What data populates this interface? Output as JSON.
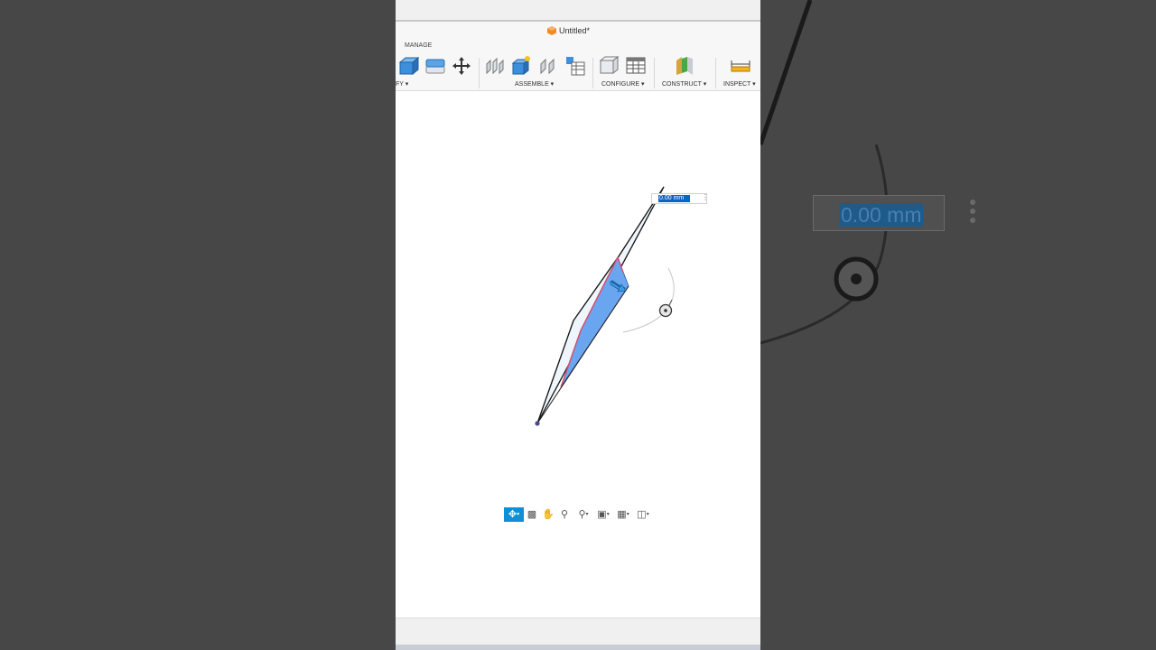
{
  "window": {
    "title": "Untitled*"
  },
  "toolbar": {
    "tab_label": "MANAGE",
    "groups": [
      {
        "label": "FY ▾"
      },
      {
        "label": "ASSEMBLE ▾"
      },
      {
        "label": "CONFIGURE ▾"
      },
      {
        "label": "CONSTRUCT ▾"
      },
      {
        "label": "INSPECT ▾"
      }
    ]
  },
  "dimension": {
    "value": "0.00 mm"
  },
  "background_zoom": {
    "value": "0.00 mm"
  },
  "icons": {
    "modify": [
      "press-pull-icon",
      "fillet-icon",
      "move-icon"
    ],
    "assemble": [
      "joint-icon",
      "new-component-icon",
      "as-built-joint-icon",
      "bom-icon"
    ],
    "configure": [
      "configure-icon",
      "table-icon"
    ],
    "construct": [
      "plane-icon"
    ],
    "inspect": [
      "measure-icon"
    ]
  },
  "nav_bar": [
    "orbit-icon",
    "look-at-icon",
    "pan-icon",
    "zoom-icon",
    "zoom-window-icon",
    "display-icon",
    "grid-icon",
    "viewports-icon"
  ],
  "colors": {
    "accent": "#0f8fd6",
    "selection_fill": "#6aa6f0",
    "selection_edge": "#d84a6a",
    "dim_highlight": "#0a64c8"
  }
}
